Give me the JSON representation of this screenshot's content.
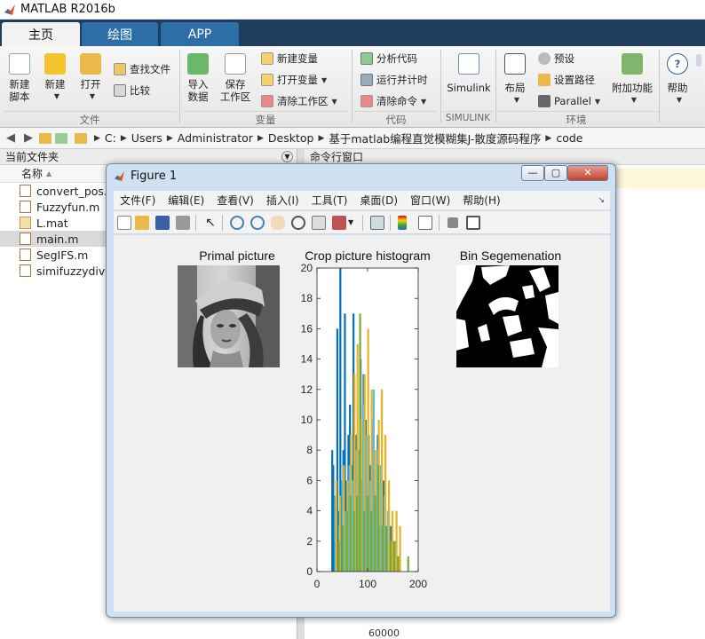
{
  "app": {
    "title": "MATLAB R2016b"
  },
  "tabs": [
    {
      "label": "主页"
    },
    {
      "label": "绘图"
    },
    {
      "label": "APP"
    }
  ],
  "ribbon": {
    "file": {
      "new_script": "新建\n脚本",
      "new": "新建",
      "open": "打开",
      "find_files": "查找文件",
      "compare": "比较",
      "group": "文件"
    },
    "variable": {
      "import_data": "导入\n数据",
      "save_workspace": "保存\n工作区",
      "new_variable": "新建变量",
      "open_variable": "打开变量",
      "clear_workspace": "清除工作区",
      "group": "变量"
    },
    "code": {
      "analyze_code": "分析代码",
      "run_and_time": "运行并计时",
      "clear_commands": "清除命令",
      "group": "代码"
    },
    "simulink": {
      "label": "Simulink",
      "group": "SIMULINK"
    },
    "environment": {
      "layout": "布局",
      "preferences": "预设",
      "set_path": "设置路径",
      "parallel": "Parallel",
      "addons": "附加功能",
      "group": "环境"
    },
    "help": {
      "label": "帮助"
    }
  },
  "address": {
    "crumbs": [
      "C:",
      "Users",
      "Administrator",
      "Desktop",
      "基于matlab编程直觉模糊集J-散度源码程序",
      "code"
    ]
  },
  "current_folder": {
    "title": "当前文件夹",
    "column": "名称",
    "files": [
      {
        "name": "convert_pos.m",
        "type": "func"
      },
      {
        "name": "Fuzzyfun.m",
        "type": "func"
      },
      {
        "name": "L.mat",
        "type": "mat"
      },
      {
        "name": "main.m",
        "type": "script",
        "selected": true
      },
      {
        "name": "SegIFS.m",
        "type": "func"
      },
      {
        "name": "simifuzzydivergence.m",
        "type": "func"
      }
    ]
  },
  "command_window": {
    "title": "命令行窗口",
    "partial_line": "60000"
  },
  "figure": {
    "title": "Figure 1",
    "menu": [
      "文件(F)",
      "编辑(E)",
      "查看(V)",
      "插入(I)",
      "工具(T)",
      "桌面(D)",
      "窗口(W)",
      "帮助(H)"
    ],
    "left_title": "Primal picture",
    "right_title": "Bin Segemenation"
  },
  "chart_data": {
    "type": "bar",
    "title": "Crop picture histogram",
    "xlabel": "",
    "ylabel": "",
    "xlim": [
      0,
      200
    ],
    "ylim": [
      0,
      20
    ],
    "xticks": [
      0,
      100,
      200
    ],
    "yticks": [
      0,
      2,
      4,
      6,
      8,
      10,
      12,
      14,
      16,
      18,
      20
    ],
    "colors": [
      "#0072BD",
      "#4DBEEE",
      "#EDB120",
      "#77AC30"
    ],
    "series": [
      {
        "values": [
          [
            30,
            8
          ],
          [
            32,
            7
          ],
          [
            34,
            2
          ],
          [
            40,
            16
          ],
          [
            42,
            4
          ],
          [
            46,
            20
          ],
          [
            48,
            5
          ],
          [
            52,
            8
          ],
          [
            55,
            17
          ],
          [
            58,
            6
          ],
          [
            62,
            9
          ],
          [
            65,
            11
          ],
          [
            68,
            7
          ],
          [
            72,
            17
          ],
          [
            75,
            5
          ],
          [
            78,
            9
          ],
          [
            82,
            8
          ],
          [
            86,
            14
          ],
          [
            89,
            6
          ],
          [
            92,
            13
          ],
          [
            96,
            10
          ],
          [
            99,
            4
          ],
          [
            102,
            9
          ],
          [
            106,
            7
          ],
          [
            110,
            10
          ],
          [
            113,
            6
          ],
          [
            116,
            5
          ],
          [
            120,
            9
          ],
          [
            124,
            3
          ],
          [
            127,
            5
          ],
          [
            131,
            6
          ],
          [
            134,
            2
          ],
          [
            138,
            3
          ],
          [
            141,
            4
          ],
          [
            146,
            3
          ],
          [
            151,
            2
          ],
          [
            156,
            1
          ],
          [
            161,
            1
          ]
        ]
      },
      {
        "values": [
          [
            36,
            5
          ],
          [
            44,
            3
          ],
          [
            50,
            6
          ],
          [
            57,
            4
          ],
          [
            64,
            7
          ],
          [
            70,
            6
          ],
          [
            77,
            8
          ],
          [
            84,
            8
          ],
          [
            91,
            11
          ],
          [
            98,
            9
          ],
          [
            105,
            6
          ],
          [
            112,
            12
          ],
          [
            119,
            8
          ],
          [
            126,
            7
          ],
          [
            133,
            5
          ],
          [
            140,
            4
          ],
          [
            148,
            2
          ],
          [
            155,
            2
          ],
          [
            163,
            1
          ]
        ]
      },
      {
        "values": [
          [
            38,
            6
          ],
          [
            45,
            5
          ],
          [
            53,
            7
          ],
          [
            60,
            6
          ],
          [
            67,
            9
          ],
          [
            74,
            13
          ],
          [
            80,
            15
          ],
          [
            87,
            10
          ],
          [
            94,
            13
          ],
          [
            101,
            16
          ],
          [
            108,
            12
          ],
          [
            115,
            8
          ],
          [
            122,
            10
          ],
          [
            128,
            12
          ],
          [
            135,
            9
          ],
          [
            142,
            6
          ],
          [
            149,
            4
          ],
          [
            157,
            4
          ],
          [
            164,
            3
          ]
        ]
      },
      {
        "values": [
          [
            43,
            2
          ],
          [
            51,
            3
          ],
          [
            59,
            4
          ],
          [
            66,
            5
          ],
          [
            73,
            4
          ],
          [
            79,
            5
          ],
          [
            85,
            17
          ],
          [
            93,
            4
          ],
          [
            100,
            5
          ],
          [
            107,
            4
          ],
          [
            114,
            5
          ],
          [
            121,
            7
          ],
          [
            129,
            3
          ],
          [
            136,
            3
          ],
          [
            145,
            2
          ],
          [
            152,
            2
          ],
          [
            160,
            1
          ],
          [
            180,
            1
          ]
        ]
      }
    ]
  }
}
